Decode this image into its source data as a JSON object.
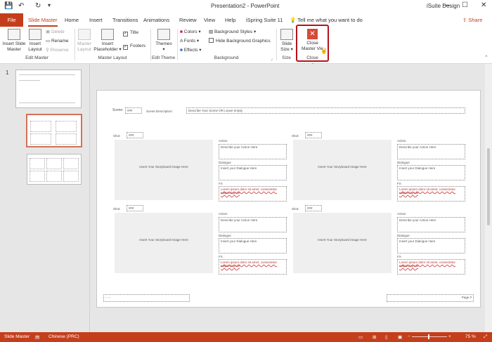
{
  "window": {
    "title": "Presentation2  -  PowerPoint",
    "user": "iSuite Design",
    "min": "—",
    "restore": "☐",
    "close": "✕",
    "save_icon": "floppy",
    "undo_icon": "↶",
    "redo_icon": "↻"
  },
  "tabs": {
    "file": "File",
    "slide_master": "Slide Master",
    "home": "Home",
    "insert": "Insert",
    "transitions": "Transitions",
    "animations": "Animations",
    "review": "Review",
    "view": "View",
    "help": "Help",
    "ispring": "iSpring Suite 11",
    "tell_me": "Tell me what you want to do",
    "share": "Share"
  },
  "ribbon": {
    "edit_master": {
      "label": "Edit Master",
      "insert_slide_master": [
        "Insert Slide",
        "Master"
      ],
      "insert_layout": [
        "Insert",
        "Layout"
      ],
      "delete": "Delete",
      "rename": "Rename",
      "preserve": "Preserve"
    },
    "master_layout": {
      "label": "Master Layout",
      "master_layout": [
        "Master",
        "Layout"
      ],
      "insert_placeholder": [
        "Insert",
        "Placeholder ▾"
      ],
      "title": "Title",
      "footers": "Footers",
      "title_checked": "✓",
      "footers_checked": "✓"
    },
    "edit_theme": {
      "label": "Edit Theme",
      "themes": [
        "Themes",
        "▾"
      ]
    },
    "background": {
      "label": "Background",
      "colors": "Colors ▾",
      "fonts": "Fonts ▾",
      "effects": "Effects ▾",
      "background_styles": "Background Styles ▾",
      "hide_graphics": "Hide Background Graphics"
    },
    "size": {
      "label": "Size",
      "slide_size": [
        "Slide",
        "Size ▾"
      ]
    },
    "close": {
      "label": "Close",
      "close_master_view": [
        "Close",
        "Master Vie"
      ],
      "icon_glyph": "✕"
    }
  },
  "thumbnails": {
    "number": "1"
  },
  "slide": {
    "scene_label": "Scene:",
    "scene_value": "###",
    "scene_desc_label": "Scene Description:",
    "scene_desc_value": "Describe Your Scene OR Leave empty",
    "panels": [
      {
        "shot_label": "Shot:",
        "shot_value": "###",
        "image_text": "Insert Your Storyboard Image Here",
        "action_label": "Action",
        "action_value": "Describe your Action Here",
        "dialogue_label": "Dialogue",
        "dialogue_value": "Insert your Dialogue Here",
        "fx_label": "FX",
        "fx_value": "Lorem ipsum dolor sit amet, consectetur adipiscing elit"
      },
      {
        "shot_label": "Shot:",
        "shot_value": "###",
        "image_text": "Insert Your Storyboard Image Here",
        "action_label": "Action",
        "action_value": "Describe your Action Here",
        "dialogue_label": "Dialogue",
        "dialogue_value": "Insert your Dialogue Here",
        "fx_label": "FX",
        "fx_value": "Lorem ipsum dolor sit amet, consectetur adipiscing elit"
      },
      {
        "shot_label": "Shot:",
        "shot_value": "###",
        "image_text": "Insert Your Storyboard Image Here",
        "action_label": "Action",
        "action_value": "Describe your Action Here",
        "dialogue_label": "Dialogue",
        "dialogue_value": "Insert your Dialogue Here",
        "fx_label": "FX",
        "fx_value": "Lorem ipsum dolor sit amet, consectetur adipiscing elit"
      },
      {
        "shot_label": "Shot:",
        "shot_value": "###",
        "image_text": "Insert Your Storyboard Image Here",
        "action_label": "Action",
        "action_value": "Describe your Action Here",
        "dialogue_label": "Dialogue",
        "dialogue_value": "Insert your Dialogue Here",
        "fx_label": "FX",
        "fx_value": "Lorem ipsum dolor sit amet, consectetur adipiscing elit"
      }
    ],
    "footer_left": "- - -",
    "footer_right": "Page #"
  },
  "status": {
    "mode": "Slide Master",
    "language": "Chinese (PRC)",
    "zoom": "75 %",
    "zoom_minus": "−",
    "zoom_plus": "+"
  },
  "colors": {
    "accent": "#c43e1c",
    "highlight": "#b5121b"
  }
}
